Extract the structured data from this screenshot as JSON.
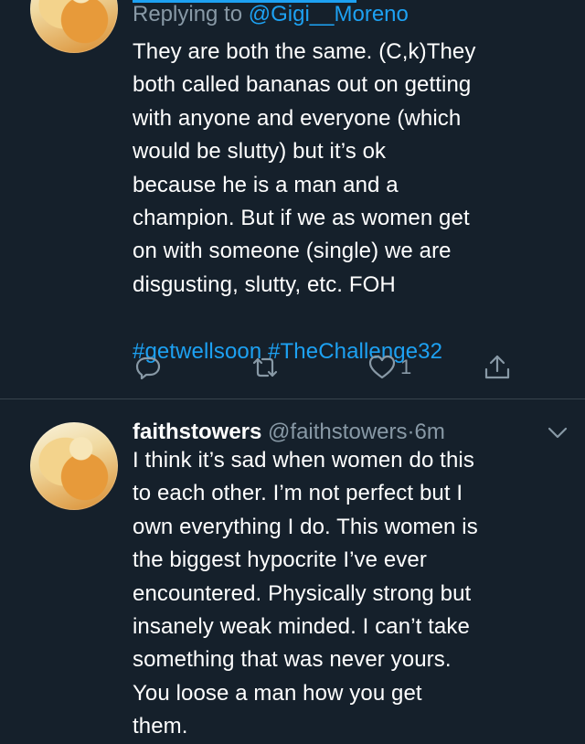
{
  "tweet1": {
    "replying_prefix": "Replying to ",
    "replying_handle": "@Gigi__Moreno",
    "text": "They are both the same. (C,k)They\nboth called bananas out on getting\nwith anyone and everyone (which\nwould be slutty) but it’s ok\nbecause he is a man and a\nchampion. But if we as women get\non with someone (single)  we are\ndisgusting, slutty, etc. FOH",
    "hashtags": [
      "#getwellsoon",
      "#TheChallenge32"
    ],
    "like_count": "1",
    "icons": [
      "reply-icon",
      "retweet-icon",
      "heart-icon",
      "share-icon"
    ]
  },
  "tweet2": {
    "name": "faithstowers",
    "handle": "@faithstowers",
    "separator": "·",
    "time": "6m",
    "text": "I think it’s sad when women do this\nto each other. I’m not perfect but I\nown everything I do. This women is\nthe biggest hypocrite I’ve ever\nencountered. Physically strong but\ninsanely weak minded. I can’t take\nsomething that was never yours.\nYou loose a man how you get\nthem."
  },
  "colors": {
    "background": "#15202b",
    "accent": "#1da1f2",
    "muted": "#8899a6",
    "divider": "#38444d"
  }
}
